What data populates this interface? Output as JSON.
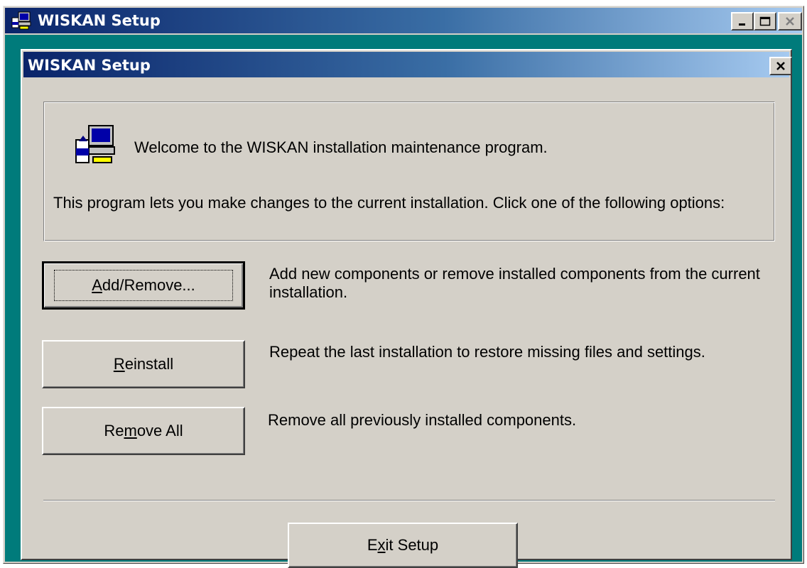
{
  "window": {
    "title": "WISKAN Setup"
  },
  "dialog": {
    "title": "WISKAN Setup",
    "welcome": "Welcome to the WISKAN installation maintenance program.",
    "intro": "This program lets you make changes to the current installation. Click one of the following options:"
  },
  "options": [
    {
      "label_pre": "",
      "label_mnemonic": "A",
      "label_post": "dd/Remove...",
      "description": "Add new components or remove installed components from the current installation."
    },
    {
      "label_pre": "",
      "label_mnemonic": "R",
      "label_post": "einstall",
      "description": "Repeat the last installation to restore missing files and settings."
    },
    {
      "label_pre": "Re",
      "label_mnemonic": "m",
      "label_post": "ove All",
      "description": "Remove all previously installed components."
    }
  ],
  "exit_button": {
    "label_pre": "E",
    "label_mnemonic": "x",
    "label_post": "it Setup"
  },
  "icons": {
    "app": "setup-computer-icon",
    "minimize": "minimize-icon",
    "maximize": "maximize-icon",
    "close": "close-icon"
  },
  "colors": {
    "title_start": "#0a246a",
    "title_end": "#a6caf0",
    "desktop": "#007b7b",
    "face": "#d4d0c8"
  }
}
